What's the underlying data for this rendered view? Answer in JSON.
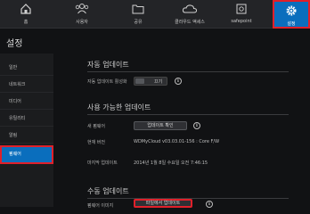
{
  "nav": {
    "items": [
      {
        "label": "홈",
        "icon": "home-icon"
      },
      {
        "label": "사용자",
        "icon": "users-icon"
      },
      {
        "label": "공유",
        "icon": "folder-icon"
      },
      {
        "label": "클라우드 액세스",
        "icon": "cloud-icon"
      },
      {
        "label": "safepoint",
        "icon": "safe-icon"
      },
      {
        "label": "설정",
        "icon": "gear-icon"
      }
    ],
    "active": "설정"
  },
  "page": {
    "title": "설정"
  },
  "sidebar": {
    "items": [
      {
        "label": "일반"
      },
      {
        "label": "네트워크"
      },
      {
        "label": "미디어"
      },
      {
        "label": "유틸리티"
      },
      {
        "label": "알림"
      },
      {
        "label": "펌웨어"
      }
    ],
    "active": "펌웨어"
  },
  "auto_update": {
    "title": "자동 업데이트",
    "enable_label": "자동 업데이트 활성화",
    "toggle_state": "끄기"
  },
  "available_update": {
    "title": "사용 가능한 업데이트",
    "new_firmware_label": "새 펌웨어",
    "check_button": "업데이트 확인",
    "current_version_label": "현재 버전",
    "current_version_value": "WDMyCloud v03.03.01-156 : Core F/W",
    "last_update_label": "마지막 업데이트",
    "last_update_value": "2014년 1월 8일 수요일 오전 7:46:15"
  },
  "manual_update": {
    "title": "수동 업데이트",
    "file_label": "펌웨어 이미지",
    "upload_button": "파일에서 업데이트"
  },
  "colors": {
    "accent": "#0a6ebd",
    "highlight": "#e0202a",
    "background": "#111214"
  }
}
